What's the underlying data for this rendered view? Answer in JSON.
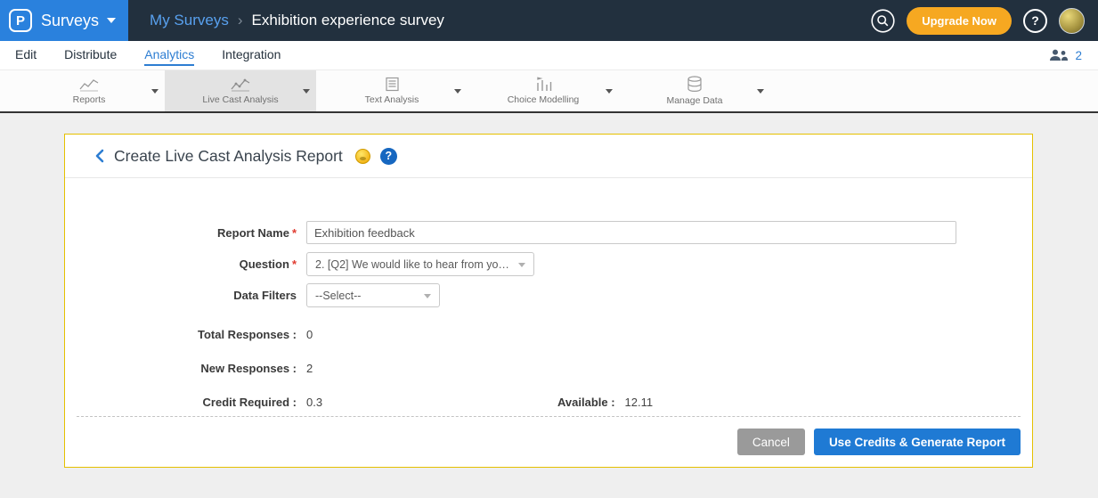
{
  "colors": {
    "topbar_bg": "#22303e",
    "brand_bg": "#2a81dd",
    "accent_blue": "#2d7dd2",
    "upgrade_orange": "#f6a821",
    "card_border": "#e5c000",
    "generate_blue": "#1f7ad4",
    "cancel_gray": "#9a9a9a"
  },
  "icons": {
    "search": "magnifier",
    "help": "question-mark-circle",
    "collaborators": "people",
    "back": "chevron-left",
    "credits": "coin",
    "dropdown": "caret-down"
  },
  "topbar": {
    "logo_letter": "P",
    "product_label": "Surveys",
    "breadcrumb_parent": "My Surveys",
    "breadcrumb_separator": "›",
    "breadcrumb_current": "Exhibition experience survey",
    "upgrade_label": "Upgrade Now",
    "help_label": "?"
  },
  "nav": {
    "items": [
      {
        "label": "Edit"
      },
      {
        "label": "Distribute"
      },
      {
        "label": "Analytics"
      },
      {
        "label": "Integration"
      }
    ],
    "collaborators_count": "2"
  },
  "toolbar": {
    "tabs": [
      {
        "label": "Reports"
      },
      {
        "label": "Live Cast Analysis"
      },
      {
        "label": "Text Analysis"
      },
      {
        "label": "Choice Modelling"
      },
      {
        "label": "Manage Data"
      }
    ]
  },
  "panel": {
    "title": "Create Live Cast Analysis Report",
    "help_label": "?",
    "form": {
      "required_marker": "*",
      "report_name_label": "Report Name",
      "report_name_value": "Exhibition feedback",
      "question_label": "Question",
      "question_value": "2. [Q2] We would like to hear from you...",
      "data_filters_label": "Data Filters",
      "data_filters_value": "--Select--",
      "total_responses_label": "Total Responses :",
      "total_responses_value": "0",
      "new_responses_label": "New Responses :",
      "new_responses_value": "2",
      "credit_required_label": "Credit Required :",
      "credit_required_value": "0.3",
      "available_label": "Available :",
      "available_value": "12.11"
    },
    "actions": {
      "cancel_label": "Cancel",
      "generate_label": "Use Credits & Generate Report"
    }
  }
}
